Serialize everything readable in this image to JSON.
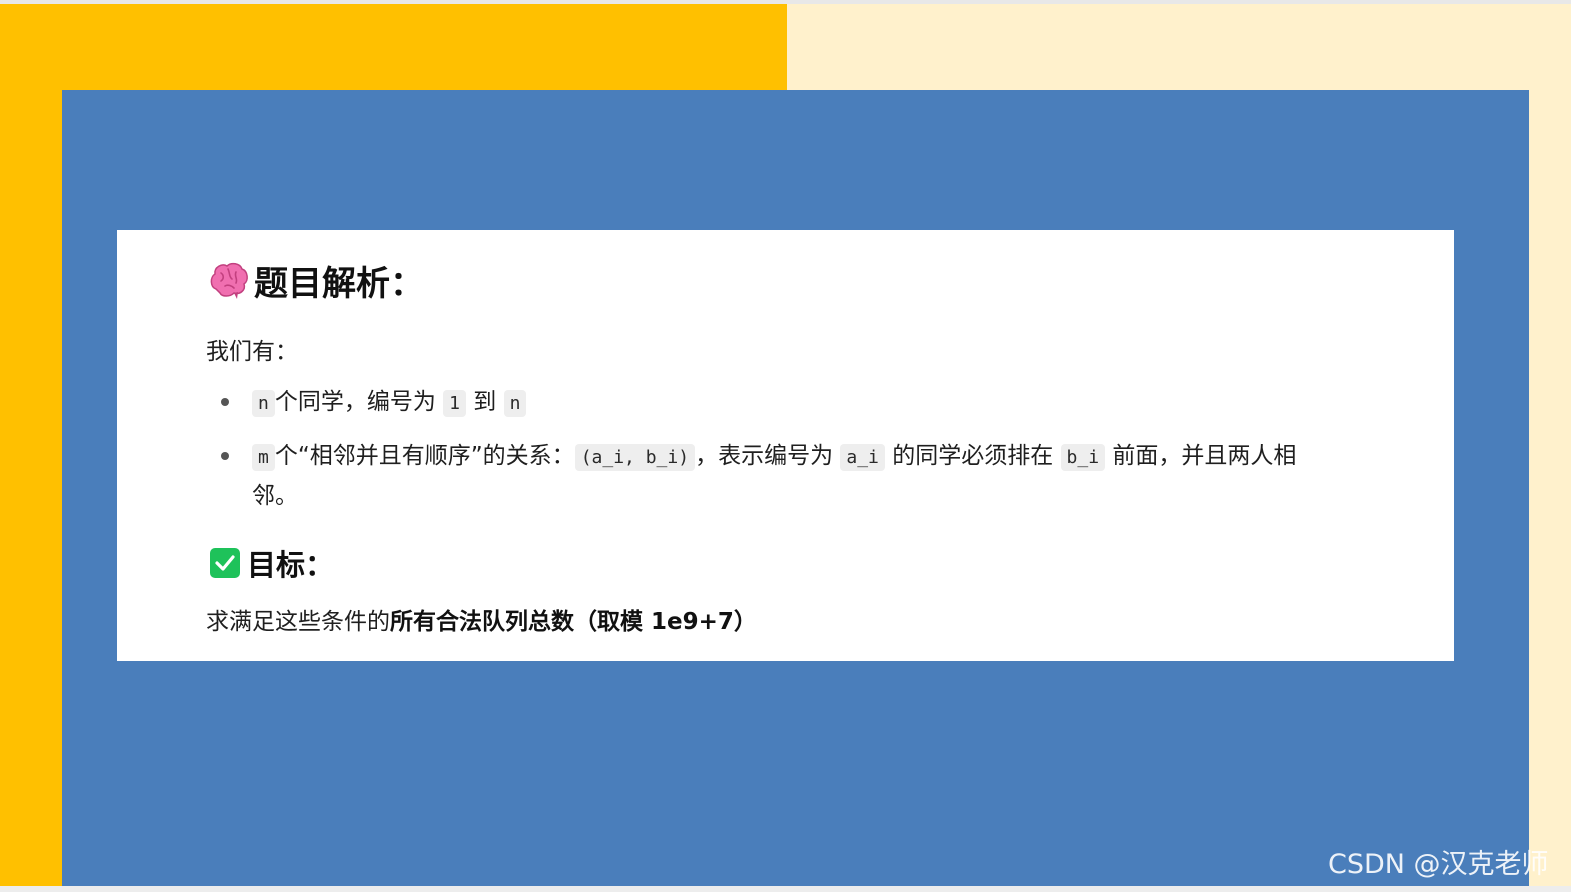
{
  "section_title": "题目解析：",
  "intro": "我们有：",
  "bullet1": {
    "code_n": "n",
    "text_a": "个同学，编号为 ",
    "code_1": "1",
    "text_b": " 到 ",
    "code_n2": "n"
  },
  "bullet2": {
    "code_m": "m",
    "text_a": "个“相邻并且有顺序”的关系：",
    "code_pair": "(a_i, b_i)",
    "text_b": "，表示编号为 ",
    "code_ai": "a_i",
    "text_c": " 的同学必须排在 ",
    "code_bi": "b_i",
    "text_d": " 前面，并且两人相邻。"
  },
  "goal_title": "目标：",
  "goal": {
    "prefix": "求满足这些条件的",
    "bold": "所有合法队列总数（取模 1e9+7）"
  },
  "watermark": "CSDN @汉克老师",
  "icons": {
    "title_icon": "brain-icon",
    "goal_icon": "check-mark-button-icon"
  },
  "colors": {
    "bg_left": "#ffc000",
    "bg_right": "#fff1cc",
    "panel": "#4a7ebb",
    "card": "#ffffff",
    "check": "#1ec25a",
    "brain": "#f06fb0"
  }
}
